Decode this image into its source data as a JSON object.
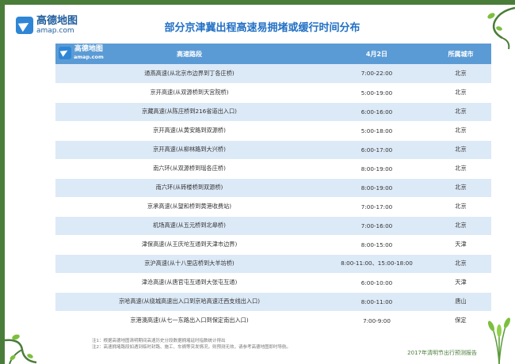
{
  "logo": {
    "cn": "高德地图",
    "en": "amap.com",
    "icon": "amap-logo-icon"
  },
  "title": "部分京津冀出程高速易拥堵或缓行时间分布",
  "table": {
    "headers": [
      "高速路段",
      "4月2日",
      "所属城市"
    ],
    "rows": [
      [
        "通燕高速(从北京市边界到丁各庄桥)",
        "7:00-22:00",
        "北京"
      ],
      [
        "京开高速(从双源桥到天宫院桥)",
        "5:00-19:00",
        "北京"
      ],
      [
        "京藏高速(从陈庄桥到216省道出入口)",
        "6:00-16:00",
        "北京"
      ],
      [
        "京开高速(从黄安路到双源桥)",
        "5:00-18:00",
        "北京"
      ],
      [
        "京开高速(从柳林路到大兴桥)",
        "6:00-17:00",
        "北京"
      ],
      [
        "南六环(从双源桥到瑶各庄桥)",
        "8:00-19:00",
        "北京"
      ],
      [
        "南六环(从砖楼桥到双源桥)",
        "8:00-19:00",
        "北京"
      ],
      [
        "京承高速(从望和桥到黄港收费站)",
        "7:00-17:00",
        "北京"
      ],
      [
        "机场高速(从五元桥到北皋桥)",
        "7:00-16:00",
        "北京"
      ],
      [
        "津保高速(从王庆坨互通到天津市边界)",
        "8:00-15:00",
        "天津"
      ],
      [
        "京沪高速(从十八里店桥到大羊坊桥)",
        "8:00-11:00、15:00-18:00",
        "北京"
      ],
      [
        "津沧高速(从唐官屯互通到大张屯互通)",
        "6:00-10:00",
        "天津"
      ],
      [
        "京哈高速(从绕城高速出入口到京哈高速迁西支线出入口)",
        "8:00-11:00",
        "唐山"
      ],
      [
        "京港澳高速(从七一东路出入口到保定南出入口)",
        "7:00-9:00",
        "保定"
      ]
    ]
  },
  "notes": [
    "注1：根据高德地图清明期间高速历史分段数据拥堵延时指数统计得出",
    "注2：高速拥堵路段如遇到临时封路、施工、车祸等突发情况，则预测无效，请参考高德地图即时导航。"
  ],
  "footer": "2017年清明节出行预测报告",
  "colors": {
    "header_bg": "#5b9bd5",
    "row_alt": "#dce9f7",
    "title": "#2270c5",
    "border": "#4a7c3a"
  }
}
